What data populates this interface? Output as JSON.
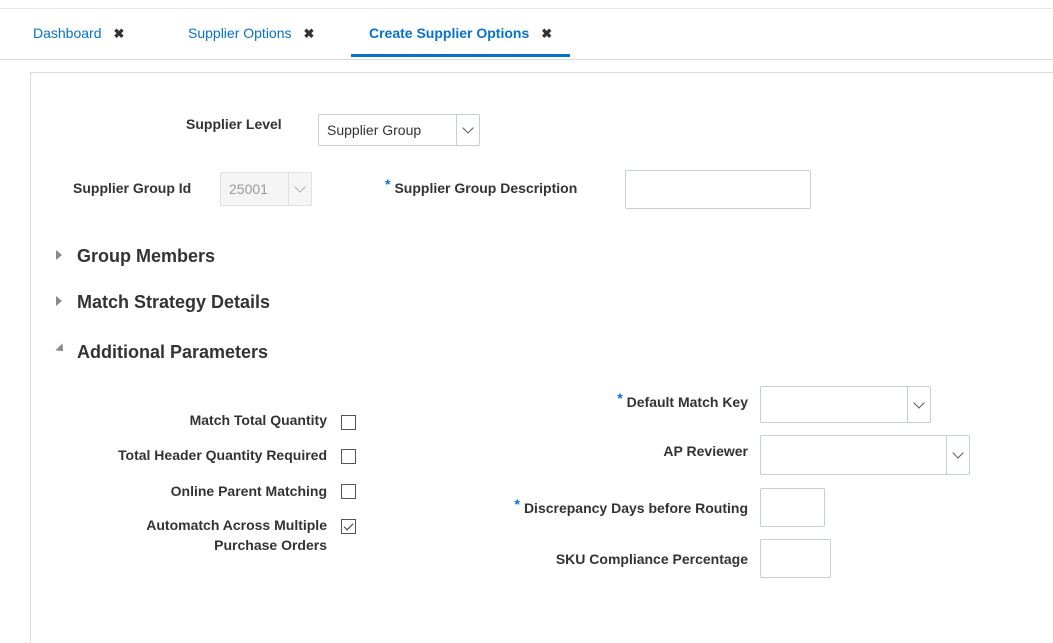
{
  "tabs": [
    {
      "label": "Dashboard",
      "close": "✖"
    },
    {
      "label": "Supplier Options",
      "close": "✖"
    },
    {
      "label": "Create Supplier Options",
      "close": "✖"
    }
  ],
  "form": {
    "supplier_level": {
      "label": "Supplier Level",
      "value": "Supplier Group"
    },
    "supplier_group_id": {
      "label": "Supplier Group Id",
      "value": "25001"
    },
    "supplier_group_description": {
      "label": "Supplier Group Description",
      "required_mark": "*",
      "value": ""
    }
  },
  "sections": {
    "group_members": "Group Members",
    "match_strategy": "Match Strategy Details",
    "additional_parameters": "Additional Parameters"
  },
  "checkboxes": [
    {
      "label": "Match Total Quantity",
      "checked": false
    },
    {
      "label": "Total Header Quantity Required",
      "checked": false
    },
    {
      "label": "Online Parent Matching",
      "checked": false
    },
    {
      "label_line1": "Automatch Across Multiple",
      "label_line2": "Purchase Orders",
      "checked": true
    }
  ],
  "params": {
    "default_match_key": {
      "label": "Default Match Key",
      "required_mark": "*",
      "value": ""
    },
    "ap_reviewer": {
      "label": "AP Reviewer",
      "value": ""
    },
    "discrepancy_days": {
      "label": "Discrepancy Days before Routing",
      "required_mark": "*",
      "value": ""
    },
    "sku_compliance": {
      "label": "SKU Compliance Percentage",
      "value": ""
    }
  },
  "colors": {
    "accent": "#0572ce",
    "text": "#333333"
  }
}
